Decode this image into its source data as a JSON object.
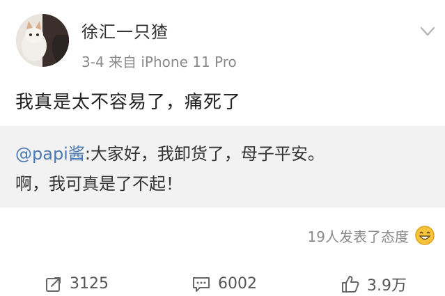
{
  "post": {
    "username": "徐汇一只猹",
    "meta": "3-4  来自 iPhone 11 Pro",
    "text": "我真是太不容易了，痛死了"
  },
  "quote": {
    "mention": "@papi酱",
    "line1_rest": ":大家好，我卸货了，母子平安。",
    "line2": "啊，我可真是了不起！"
  },
  "reactions": {
    "text": "19人发表了态度"
  },
  "actions": {
    "repost": "3125",
    "comment": "6002",
    "like": "3.9万"
  },
  "icons": {
    "avatar": "avatar-cat-photo",
    "menu": "chevron-down-icon",
    "face": "smile-face-icon",
    "repost": "repost-icon",
    "comment": "comment-icon",
    "like": "thumbs-up-icon"
  }
}
